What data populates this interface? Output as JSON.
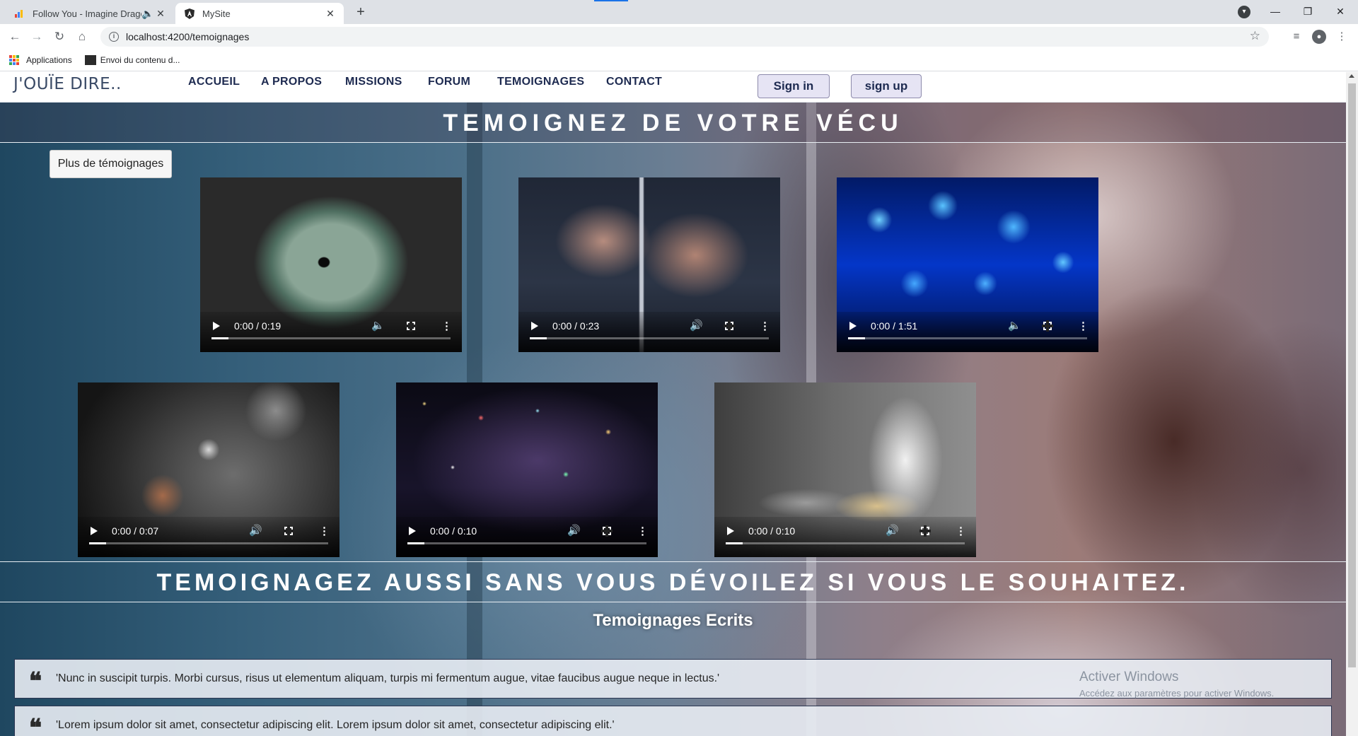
{
  "browser": {
    "tabs": [
      {
        "title": "Follow You - Imagine Dragon",
        "icon": "chart-favicon-icon",
        "audio": true
      },
      {
        "title": "MySite",
        "icon": "angular-icon"
      }
    ],
    "new_tab_symbol": "+",
    "url": "localhost:4200/temoignages",
    "bookmarks": [
      "Applications",
      "Envoi du contenu d..."
    ]
  },
  "site": {
    "brand": "J'OUÏE DIRE..",
    "menu": [
      "ACCUEIL",
      "A PROPOS",
      "MISSIONS",
      "FORUM",
      "TEMOIGNAGES",
      "CONTACT"
    ],
    "sign_in": "Sign in",
    "sign_up": "sign up"
  },
  "main": {
    "heading": "TEMOIGNEZ DE VOTRE VÉCU",
    "more_button": "Plus de témoignages",
    "videos": [
      {
        "time": "0:00 / 0:19",
        "subject": "cat-eye",
        "muted": true
      },
      {
        "time": "0:00 / 0:23",
        "subject": "hands-washing",
        "muted": false
      },
      {
        "time": "0:00 / 1:51",
        "subject": "jellyfish",
        "muted": true
      },
      {
        "time": "0:00 / 0:07",
        "subject": "watch-mechanism",
        "muted": false
      },
      {
        "time": "0:00 / 0:10",
        "subject": "bokeh-lights",
        "muted": false
      },
      {
        "time": "0:00 / 0:10",
        "subject": "chef-cooking",
        "muted": false
      }
    ],
    "banner2": "TEMOIGNAGEZ AUSSI SANS VOUS DÉVOILEZ SI VOUS LE SOUHAITEZ.",
    "written_title": "Temoignages Ecrits",
    "quote_mark": "❝",
    "quotes": [
      "'Nunc in suscipit turpis. Morbi cursus, risus ut elementum aliquam, turpis mi fermentum augue, vitae faucibus augue neque in lectus.'",
      "'Lorem ipsum dolor sit amet, consectetur adipiscing elit. Lorem ipsum dolor sit amet, consectetur adipiscing elit.'"
    ]
  },
  "os_watermark": {
    "line1": "Activer Windows",
    "line2": "Accédez aux paramètres pour activer Windows."
  },
  "colors": {
    "nav_text": "#1d2a50",
    "auth_button_bg": "#e6e4f4",
    "chrome_accent": "#1a73e8"
  }
}
